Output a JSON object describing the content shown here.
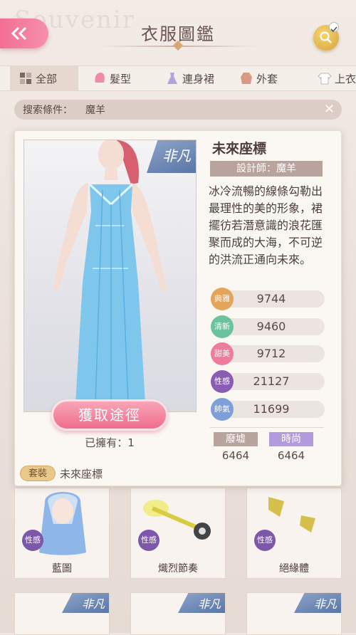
{
  "header": {
    "title": "衣服圖鑑",
    "watermark": "Souvenir"
  },
  "tabs": [
    {
      "label": "全部"
    },
    {
      "label": "髮型"
    },
    {
      "label": "連身裙"
    },
    {
      "label": "外套"
    },
    {
      "label": "上衣"
    }
  ],
  "filter": {
    "label": "搜索條件：",
    "value": "魔羊",
    "clear": "✕"
  },
  "item": {
    "name": "未來座標",
    "rarity": "非凡",
    "designer": "設計師：魔羊",
    "description": "冰冷流暢的線條勾勒出最理性的美的形象，裙擺彷若潛意識的浪花匯聚而成的大海，不可逆的洪流正通向未來。",
    "get_button": "獲取途徑",
    "owned": "已擁有：1",
    "stats": [
      {
        "name": "典雅",
        "value": "9744",
        "color": "#e4a55a"
      },
      {
        "name": "清新",
        "value": "9460",
        "color": "#6bc29c"
      },
      {
        "name": "甜美",
        "value": "9712",
        "color": "#ef7c9b"
      },
      {
        "name": "性感",
        "value": "21127",
        "color": "#8a5db4"
      },
      {
        "name": "帥氣",
        "value": "11699",
        "color": "#7f9fd9"
      }
    ],
    "attributes": [
      {
        "label": "廢墟",
        "value": "6464",
        "color": "#b8a49c"
      },
      {
        "label": "時尚",
        "value": "6464",
        "color": "#b19bdc"
      }
    ],
    "suit_label": "套裝",
    "suit_name": "未來座標"
  },
  "grid": [
    {
      "name": "藍圖",
      "badge": "性感"
    },
    {
      "name": "熾烈節奏",
      "badge": "性感"
    },
    {
      "name": "絕緣體",
      "badge": "性感"
    }
  ],
  "bottom_tags": [
    "非凡",
    "非凡",
    "非凡"
  ]
}
